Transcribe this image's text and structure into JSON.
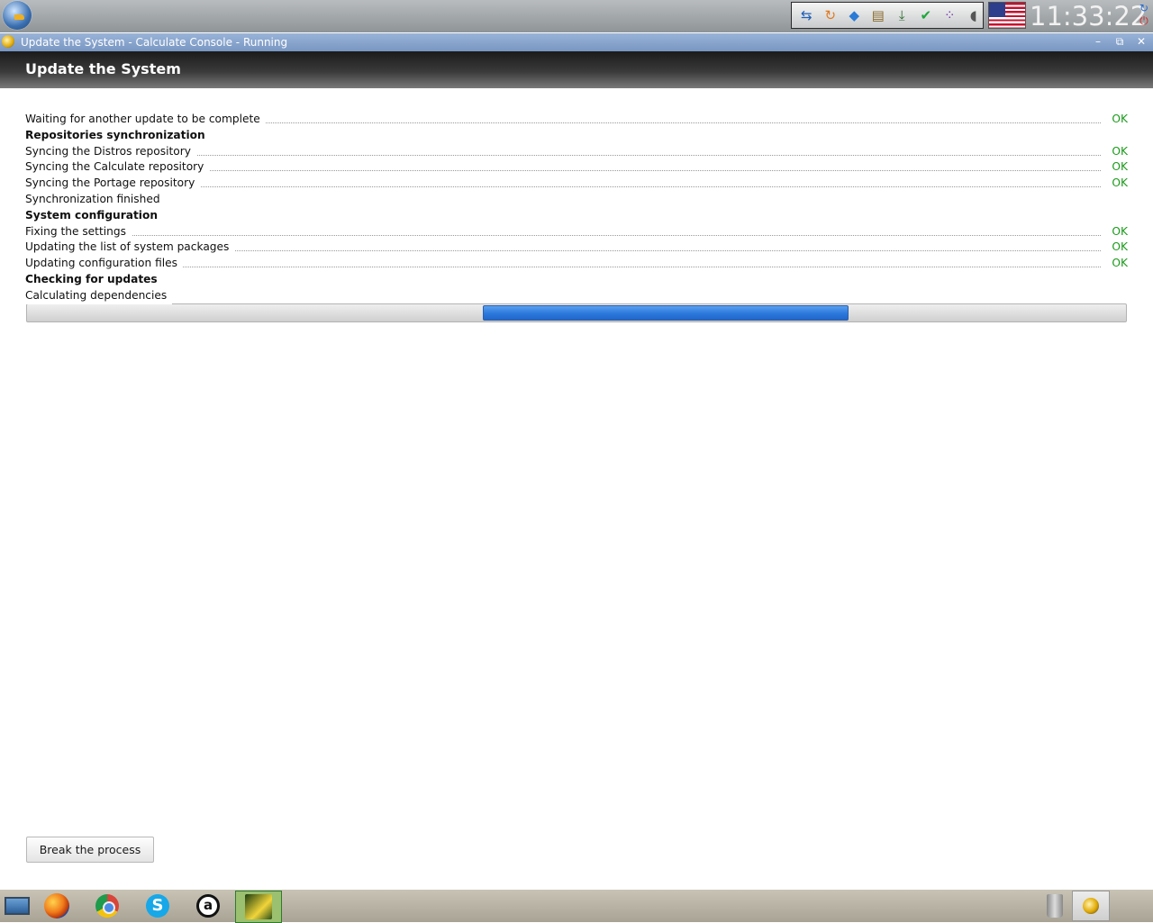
{
  "top_panel": {
    "menu_icon": "calculate-linux-menu-icon",
    "tray_icons": [
      "teamviewer-icon",
      "refresh-icon",
      "network-diamond-icon",
      "clipboard-icon",
      "download-icon",
      "shield-check-icon",
      "dots-icon",
      "volume-icon"
    ],
    "keyboard_layout_icon": "us-flag-icon",
    "clock": "11:33:22"
  },
  "window": {
    "title": "Update the System - Calculate Console - Running",
    "controls": [
      "minimize",
      "restore",
      "close"
    ]
  },
  "header": {
    "title": "Update the System"
  },
  "log": [
    {
      "text": "Waiting for another update to be complete",
      "status": "OK",
      "bold": false
    },
    {
      "text": "Repositories synchronization",
      "status": "",
      "bold": true
    },
    {
      "text": "Syncing the Distros repository",
      "status": "OK",
      "bold": false
    },
    {
      "text": "Syncing the Calculate repository",
      "status": "OK",
      "bold": false
    },
    {
      "text": "Syncing the Portage repository",
      "status": "OK",
      "bold": false
    },
    {
      "text": "Synchronization finished",
      "status": "",
      "bold": false
    },
    {
      "text": "System configuration",
      "status": "",
      "bold": true
    },
    {
      "text": "Fixing the settings",
      "status": "OK",
      "bold": false
    },
    {
      "text": "Updating the list of system packages",
      "status": "OK",
      "bold": false
    },
    {
      "text": "Updating configuration files",
      "status": "OK",
      "bold": false
    },
    {
      "text": "Checking for updates",
      "status": "",
      "bold": true
    },
    {
      "text": "Calculating dependencies",
      "status": "",
      "bold": false
    }
  ],
  "progress": {
    "mode": "indeterminate",
    "chunk_start": 0.415,
    "chunk_end": 0.748
  },
  "actions": {
    "break_label": "Break the process"
  },
  "taskbar": {
    "launchers": [
      "show-desktop-icon",
      "firefox-icon",
      "chrome-icon",
      "skype-icon",
      "amarok-icon",
      "calculate-console-icon"
    ],
    "right": [
      "trash-icon",
      "calculate-console-task-icon"
    ]
  },
  "colors": {
    "ok": "#1a9a1a",
    "progress": "#2b78dd",
    "titlebar": "#8aa6d0"
  }
}
